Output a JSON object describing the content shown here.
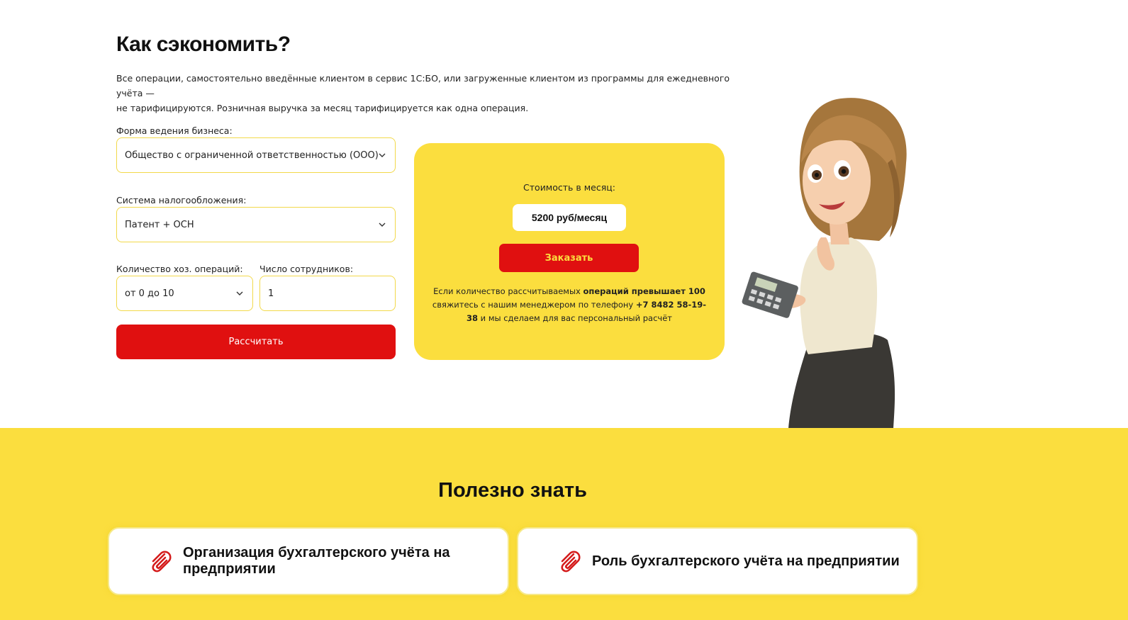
{
  "calculator": {
    "heading": "Как сэкономить?",
    "intro_line1": "Все операции, самостоятельно введённые клиентом в сервис 1С:БО, или загруженные клиентом из программы для ежедневного учёта —",
    "intro_line2": "не тарифицируются. Розничная выручка за месяц тарифицируется как одна операция.",
    "business_form": {
      "label": "Форма ведения бизнеса:",
      "value": "Общество с ограниченной ответственностью (ООО)"
    },
    "tax_system": {
      "label": "Система налогообложения:",
      "value": "Патент + ОСН"
    },
    "operations": {
      "label": "Количество хоз. операций:",
      "value": "от 0 до 10"
    },
    "employees": {
      "label": "Число сотрудников:",
      "value": "1"
    },
    "calculate_label": "Рассчитать"
  },
  "price_card": {
    "label": "Стоимость в месяц:",
    "price": "5200 руб/месяц",
    "order_label": "Заказать",
    "note_part1": "Если количество рассчитываемых ",
    "note_bold1": "операций превышает 100",
    "note_part2": " свяжитесь с нашим менеджером по телефону ",
    "note_phone": "+7 8482 58-19-38",
    "note_part3": " и мы сделаем для вас персональный расчёт"
  },
  "useful": {
    "title": "Полезно знать",
    "articles": [
      {
        "title": "Организация бухгалтерского учёта на предприятии",
        "icon": "paperclip-icon"
      },
      {
        "title": "Роль бухгалтерского учёта на предприятии",
        "icon": "paperclip-icon"
      }
    ]
  },
  "colors": {
    "accent_yellow": "#fbde3e",
    "accent_red": "#e01010",
    "field_border": "#f2d94a"
  }
}
